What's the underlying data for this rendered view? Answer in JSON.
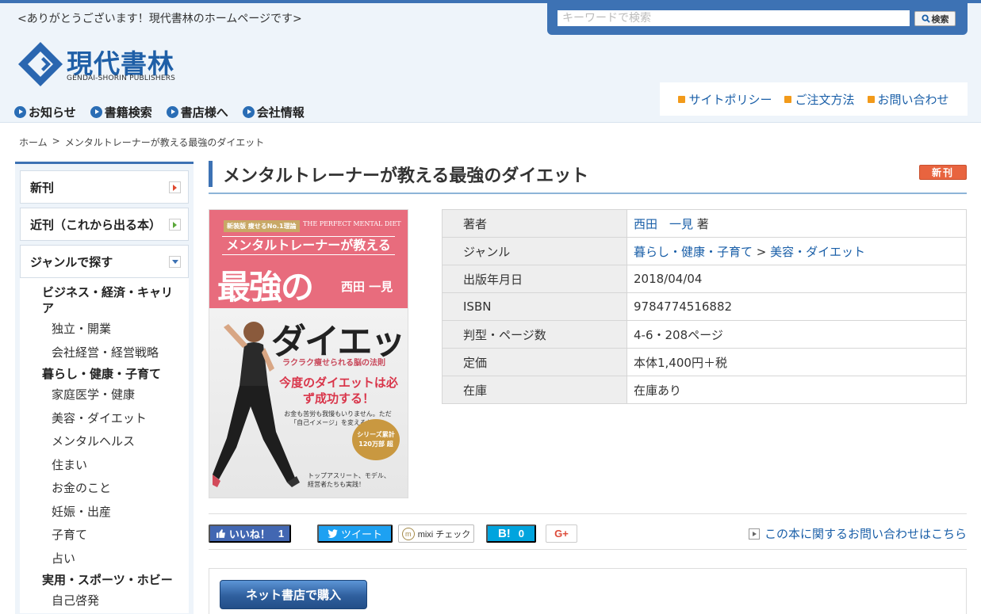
{
  "header": {
    "tagline": "<ありがとうございます！現代書林のホームページです>",
    "search_placeholder": "キーワードで検索",
    "search_button": "検索",
    "logo_name": "現代書林",
    "logo_en": "GENDAI-SHORIN PUBLISHERS",
    "util_links": [
      "サイトポリシー",
      "ご注文方法",
      "お問い合わせ"
    ],
    "nav": [
      "お知らせ",
      "書籍検索",
      "書店様へ",
      "会社情報"
    ]
  },
  "breadcrumb": {
    "home": "ホーム",
    "sep": ">",
    "current": "メンタルトレーナーが教える最強のダイエット"
  },
  "sidebar": {
    "tabs": [
      "新刊",
      "近刊（これから出る本）",
      "ジャンルで探す"
    ],
    "genres": [
      {
        "type": "cat",
        "label": "ビジネス・経済・キャリア"
      },
      {
        "type": "sub",
        "label": "独立・開業"
      },
      {
        "type": "sub",
        "label": "会社経営・経営戦略"
      },
      {
        "type": "cat",
        "label": "暮らし・健康・子育て"
      },
      {
        "type": "sub",
        "label": "家庭医学・健康"
      },
      {
        "type": "sub",
        "label": "美容・ダイエット"
      },
      {
        "type": "sub",
        "label": "メンタルヘルス"
      },
      {
        "type": "sub",
        "label": "住まい"
      },
      {
        "type": "sub",
        "label": "お金のこと"
      },
      {
        "type": "sub",
        "label": "妊娠・出産"
      },
      {
        "type": "sub",
        "label": "子育て"
      },
      {
        "type": "sub",
        "label": "占い"
      },
      {
        "type": "cat",
        "label": "実用・スポーツ・ホビー"
      },
      {
        "type": "sub",
        "label": "自己啓発"
      }
    ]
  },
  "book": {
    "title": "メンタルトレーナーが教える最強のダイエット",
    "badge": "新刊",
    "cover": {
      "tag": "新装版 痩せるNo.1理論",
      "en_title": "THE PERFECT MENTAL DIET",
      "sub": "メンタルトレーナーが教える",
      "main1": "最強の",
      "author": "西田 一見",
      "main2": "ダイエット",
      "catch": "ラクラク痩せられる脳の法則",
      "lead": "今度のダイエットは必ず成功する！",
      "note": "お金も苦労も我慢もいりません。ただ「自己イメージ」を変えるだけ！",
      "seal": "シリーズ累計 120万部 超",
      "foot": "トップアスリート、モデル、経営者たちも実践！"
    },
    "info": [
      {
        "label": "著者",
        "value": "西田　一見",
        "suffix": "著",
        "link": true
      },
      {
        "label": "ジャンル",
        "genre_main": "暮らし・健康・子育て",
        "sep": ">",
        "genre_sub": "美容・ダイエット"
      },
      {
        "label": "出版年月日",
        "value": "2018/04/04"
      },
      {
        "label": "ISBN",
        "value": "9784774516882"
      },
      {
        "label": "判型・ページ数",
        "value": "4-6・208ページ"
      },
      {
        "label": "定価",
        "value": "本体1,400円＋税"
      },
      {
        "label": "在庫",
        "value": "在庫あり"
      }
    ]
  },
  "share": {
    "facebook": "いいね！",
    "facebook_count": "1",
    "twitter": "ツイート",
    "mixi": "mixi チェック",
    "hatena": "B!",
    "hatena_count": "0",
    "gplus": "G+",
    "inquiry": "この本に関するお問い合わせはこちら"
  },
  "buy": {
    "button": "ネット書店で購入"
  },
  "colors": {
    "brand": "#3d72b4",
    "link": "#1a5fa8",
    "badge": "#e8643f"
  }
}
